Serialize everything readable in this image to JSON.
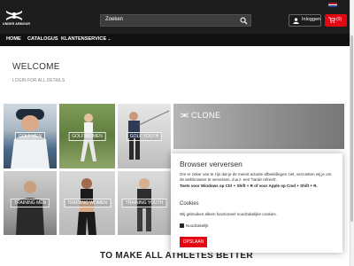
{
  "header": {
    "brand_tagline": "UNDER ARMOUR",
    "search_placeholder": "Zoeken",
    "login_label": "Inloggen",
    "cart_count": "(0)",
    "flag_colors": [
      "#ae1c28",
      "#ffffff",
      "#21468b"
    ]
  },
  "nav": {
    "items": [
      "HOME",
      "CATALOGUS",
      "KLANTENSERVICE"
    ]
  },
  "main": {
    "title": "WELCOME",
    "subtitle": "LOGIN FOR ALL DETAILS",
    "tiles": [
      {
        "label": "GOLF MEN"
      },
      {
        "label": "GOLF WOMEN"
      },
      {
        "label": "GOLF YOUTH"
      },
      {
        "label": "TRAINING MEN"
      },
      {
        "label": "TRAINING WOMEN"
      },
      {
        "label": "TRAINING YOUTH"
      }
    ],
    "banner_label": "CLONE",
    "bottom_text": "TO MAKE ALL ATHLETES BETTER"
  },
  "popup": {
    "title": "Browser verversen",
    "body": "Om er zeker van te zijn dat je de meest actuele afbeeldingen ziet, verzoeken wij je om de webbrowser te verversen, d.w.z. een 'harde refresh'.",
    "shortcut": "Toets voor Windows op Ctrl + Shift + R of voor Apple op Cmd + Shift + R.",
    "cookies_title": "Cookies",
    "cookies_body": "Wij gebruiken alleen functioneel noodzakelijke cookies.",
    "checkbox_label": "Noodzakelijk",
    "save_label": "OPSLAAN"
  },
  "colors": {
    "accent": "#e30613",
    "header_bg": "#1d1d1d",
    "nav_bg": "#111111"
  }
}
